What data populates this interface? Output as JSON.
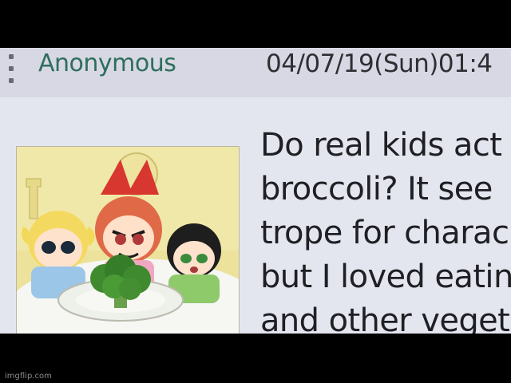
{
  "post": {
    "name": "Anonymous",
    "date": "04/07/19(Sun)01:4",
    "lines": [
      "Do real kids act",
      "broccoli? It see",
      "trope for charac",
      "but I loved eatin",
      "and other veget"
    ]
  },
  "footer": {
    "watermark": "imgflip.com"
  },
  "colors": {
    "name_green": "#2e6e5c",
    "header_bg": "#d7d8e3",
    "post_bg": "#e4e6ef",
    "letterbox": "#000000"
  },
  "icons": {
    "menu": "vertical-ellipsis-icon"
  }
}
